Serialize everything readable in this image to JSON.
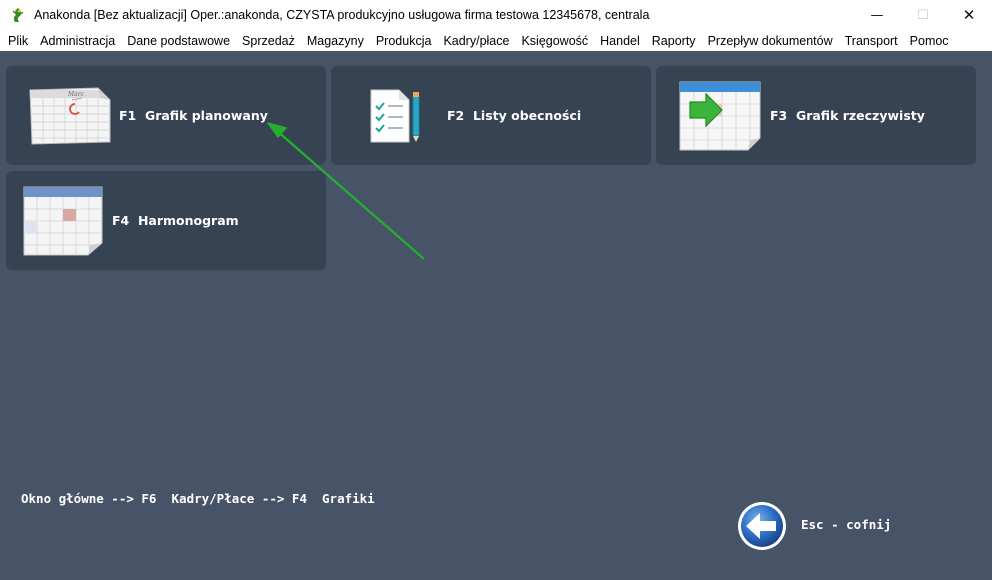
{
  "window": {
    "title": "Anakonda [Bez aktualizacji] Oper.:anakonda, CZYSTA produkcyjno usługowa firma testowa 12345678, centrala",
    "controls": {
      "minimize": "—",
      "maximize": "☐",
      "close": "✕"
    }
  },
  "menu": [
    "Plik",
    "Administracja",
    "Dane podstawowe",
    "Sprzedaż",
    "Magazyny",
    "Produkcja",
    "Kadry/płace",
    "Księgowość",
    "Handel",
    "Raporty",
    "Przepływ dokumentów",
    "Transport",
    "Pomoc"
  ],
  "tiles": {
    "f1": {
      "label": "F1  Grafik planowany",
      "icon": "calendar-icon",
      "calendar_month": "Marc"
    },
    "f2": {
      "label": "F2  Listy obecności",
      "icon": "checklist-icon"
    },
    "f3": {
      "label": "F3  Grafik rzeczywisty",
      "icon": "calendar-arrow-icon"
    },
    "f4": {
      "label": "F4  Harmonogram",
      "icon": "schedule-icon"
    }
  },
  "breadcrumb": "Okno główne --> F6  Kadry/Płace --> F4  Grafiki",
  "back": {
    "label": "Esc - cofnij",
    "icon": "back-arrow-icon"
  },
  "colors": {
    "background": "#475468",
    "tile": "#364352",
    "annotation_arrow": "#22b02e"
  }
}
